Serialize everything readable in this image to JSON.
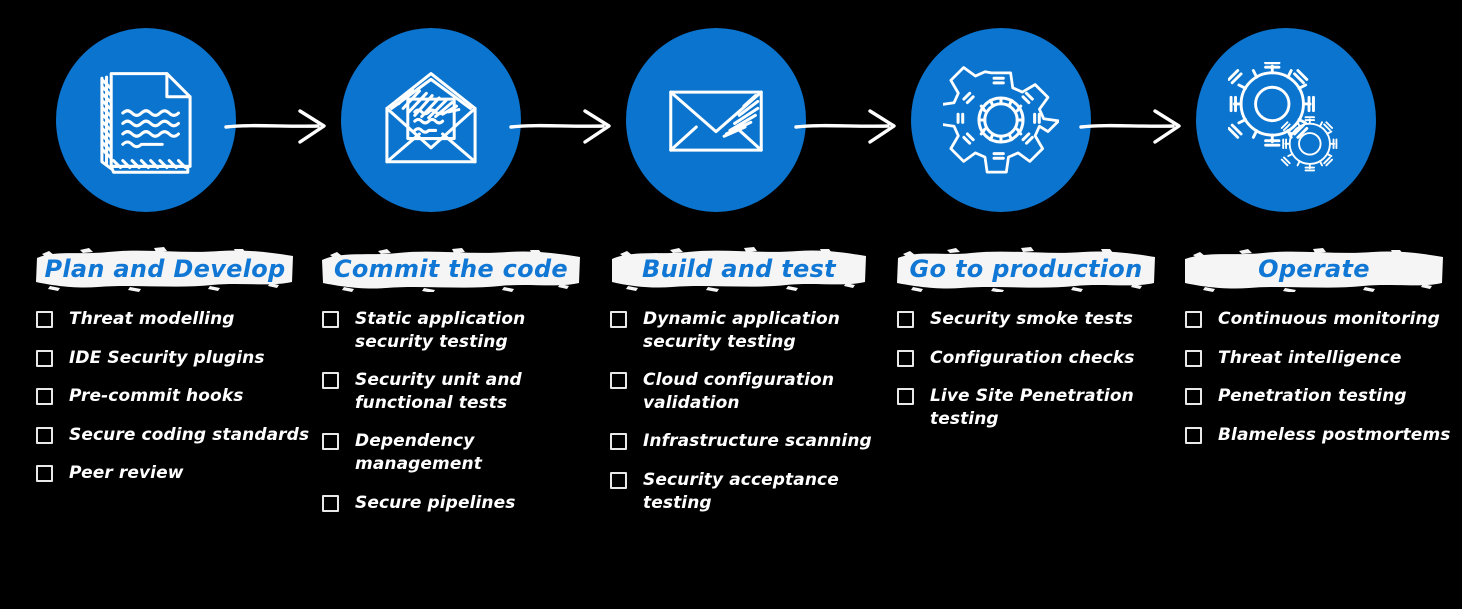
{
  "theme": {
    "background": "#000000",
    "accent_blue": "#0B74CE",
    "heading_blue": "#1177D4",
    "banner_white": "#F5F5F5",
    "text_white": "#FFFFFF"
  },
  "pipeline": {
    "arrow_count": 4,
    "stages": [
      {
        "icon": "document-icon",
        "title": "Plan and Develop"
      },
      {
        "icon": "open-envelope-icon",
        "title": "Commit the code"
      },
      {
        "icon": "closed-envelope-icon",
        "title": "Build and test"
      },
      {
        "icon": "gear-icon",
        "title": "Go to production"
      },
      {
        "icon": "double-gear-icon",
        "title": "Operate"
      }
    ]
  },
  "columns": [
    {
      "title": "Plan and Develop",
      "items": [
        "Threat modelling",
        "IDE Security plugins",
        "Pre-commit hooks",
        "Secure coding standards",
        "Peer review"
      ]
    },
    {
      "title": "Commit the code",
      "items": [
        "Static application security testing",
        "Security unit and functional tests",
        "Dependency management",
        "Secure pipelines"
      ]
    },
    {
      "title": "Build and test",
      "items": [
        "Dynamic application security testing",
        "Cloud configuration validation",
        "Infrastructure scanning",
        "Security acceptance testing"
      ]
    },
    {
      "title": "Go to production",
      "items": [
        "Security smoke tests",
        "Configuration checks",
        "Live Site Penetration testing"
      ]
    },
    {
      "title": "Operate",
      "items": [
        "Continuous monitoring",
        "Threat intelligence",
        "Penetration testing",
        "Blameless postmortems"
      ]
    }
  ]
}
